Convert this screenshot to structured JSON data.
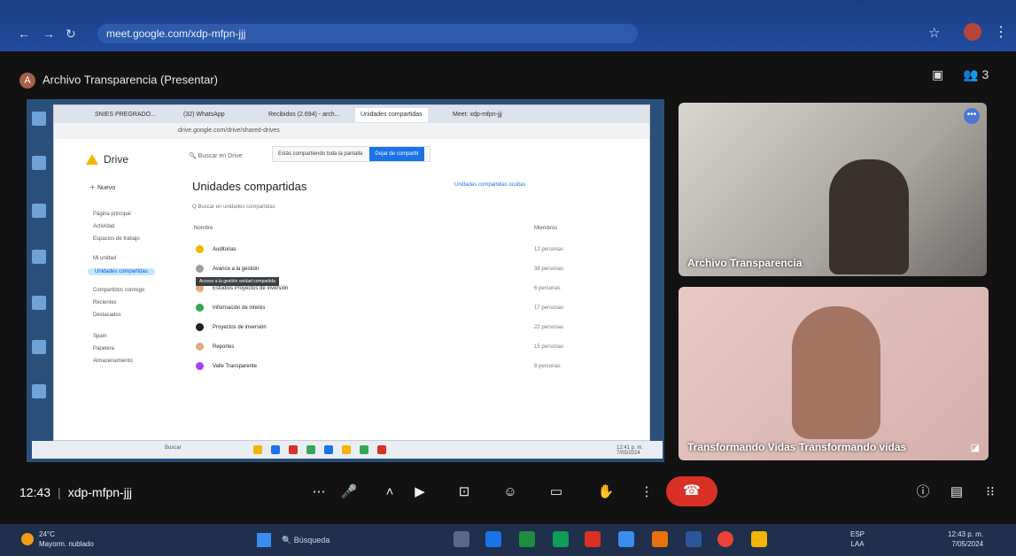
{
  "browser": {
    "url": "meet.google.com/xdp-mfpn-jjj",
    "url_rest": "/xdp-mfpn-jjj"
  },
  "meet": {
    "presenter_label": "Archivo Transparencia (Presentar)",
    "presenter_initial": "A",
    "time": "12:43",
    "meeting_code": "xdp-mfpn-jjj",
    "participant_count": "3"
  },
  "shared_screen": {
    "tabs": [
      "SNIES PREGRADO...",
      "(32) WhatsApp",
      "Recibidos (2.694) - arch...",
      "Unidades compartidas",
      "Meet: xdp-mfpn-jjj"
    ],
    "url": "drive.google.com/drive/shared-drives",
    "app_name": "Drive",
    "new_button": "Nuevo",
    "search_placeholder": "Buscar en Drive",
    "sharing_toast": "Estás compartiendo toda la pantalla",
    "stop_sharing": "Dejar de compartir",
    "sidebar_items": [
      "Página principal",
      "Actividad",
      "Espacios de trabajo",
      "Mi unidad",
      "Unidades compartidas",
      "Compartidos conmigo",
      "Recientes",
      "Destacados",
      "Spam",
      "Papelera",
      "Almacenamiento"
    ],
    "page_title": "Unidades compartidas",
    "new_shared_link": "Unidades compartidas ocultas",
    "filter_text": "Q Buscar en unidades compartidas",
    "col_name": "Nombre",
    "col_members": "Miembros",
    "rows": [
      {
        "name": "Auditorias",
        "members": "12 personas",
        "color": "#f4b400"
      },
      {
        "name": "Avance a la gestión",
        "members": "38 personas",
        "color": "#9aa0a6"
      },
      {
        "name": "Estudios Proyectos de inversión",
        "members": "6 personas",
        "color": "#e8a87c"
      },
      {
        "name": "Información de interés",
        "members": "17 personas",
        "color": "#34a853"
      },
      {
        "name": "Proyectos de inversión",
        "members": "22 personas",
        "color": "#202124"
      },
      {
        "name": "Reportes",
        "members": "15 personas",
        "color": "#e8a87c"
      },
      {
        "name": "Valle Transparente",
        "members": "8 personas",
        "color": "#a142f4"
      }
    ],
    "tooltip": "Acceso a la gestión unidad compartida",
    "inner_taskbar_search": "Buscar",
    "inner_clock": "12:41 p. m. 7/05/2024"
  },
  "tiles": [
    {
      "name": "Archivo Transparencia"
    },
    {
      "name": "Transformando Vidas Transformando vidas"
    }
  ],
  "taskbar": {
    "temperature": "24°C",
    "weather_text": "Mayorm. nublado",
    "search_placeholder": "Búsqueda",
    "language": "ESP",
    "layout": "LAA",
    "time": "12:43 p. m.",
    "date": "7/05/2024"
  },
  "colors": {
    "end_call": "#d93025",
    "accent": "#1a73e8"
  }
}
